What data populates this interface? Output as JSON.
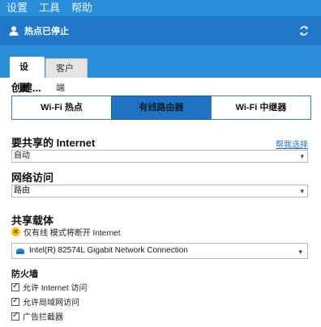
{
  "menu": {
    "items": [
      "设置",
      "工具",
      "帮助"
    ]
  },
  "status": {
    "text": "热点已停止",
    "icon": "user-icon",
    "refresh_icon": "refresh-icon"
  },
  "tabs": {
    "active": "设置",
    "inactive": "客户端"
  },
  "create": {
    "title": "创建...",
    "modes": [
      "Wi-Fi 热点",
      "有线路由器",
      "Wi-Fi 中继器"
    ],
    "active_mode": "有线路由器"
  },
  "internet": {
    "title": "要共享的 Internet",
    "help_link": "帮我选择",
    "value": "自动"
  },
  "network_access": {
    "title": "网络访问",
    "value": "路由"
  },
  "shared_medium": {
    "title": "共享载体",
    "warning": "仅有线 模式将断开 Internet",
    "adapter": "Intel(R) 82574L Gigabit Network Connection"
  },
  "firewall": {
    "title": "防火墙",
    "options": [
      "允许 Internet 访问",
      "允许局域网访问",
      "广告拦截器"
    ]
  },
  "colors": {
    "menubar": "#2a8fd8",
    "statusbar": "#1f78c8",
    "accent": "#1f73c2"
  }
}
